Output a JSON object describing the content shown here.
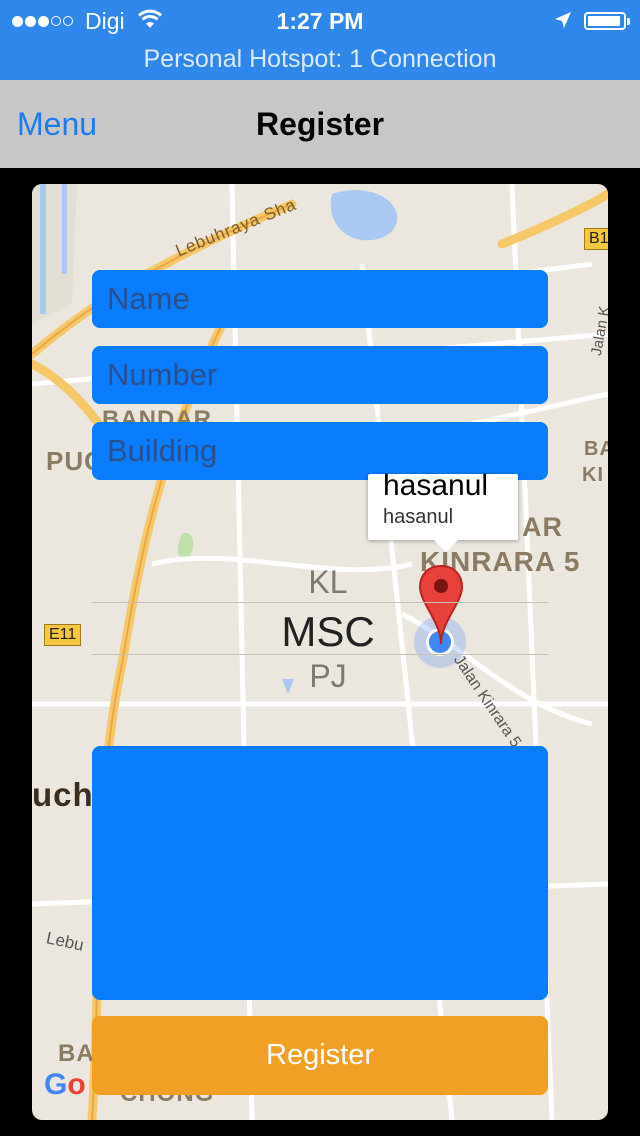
{
  "status_bar": {
    "carrier": "Digi",
    "time": "1:27 PM",
    "hotspot": "Personal Hotspot: 1 Connection",
    "battery_level": 0.95,
    "signal_bars": 3
  },
  "nav": {
    "back_label": "Menu",
    "title": "Register"
  },
  "form": {
    "name_placeholder": "Name",
    "number_placeholder": "Number",
    "building_placeholder": "Building",
    "register_label": "Register"
  },
  "map": {
    "callout_title": "hasanul",
    "callout_subtitle": "hasanul",
    "labels": {
      "lebuhraya": "Lebuhraya Sha",
      "bandar": "BANDAR",
      "puc": "PUC",
      "ar": "AR",
      "kinrara": "KINRARA 5",
      "ba_right": "BA",
      "ki_right": "KI",
      "e11": "E11",
      "b_top": "B1",
      "jalan_kinrara": "Jalan Kinrara 5",
      "jalan_right": "Jalan K",
      "ucho": "ucho",
      "lebu": "Lebu",
      "ba_bottom": "BA",
      "chong": "CHONG",
      "google": "Go"
    },
    "picker": {
      "above": "KL",
      "selected": "MSC",
      "below": "PJ"
    }
  },
  "colors": {
    "status_bg": "#2f86eb",
    "nav_bg": "#c7c7c7",
    "field_bg": "#0a7cff",
    "button_bg": "#f0a024",
    "pin": "#e8403a"
  }
}
